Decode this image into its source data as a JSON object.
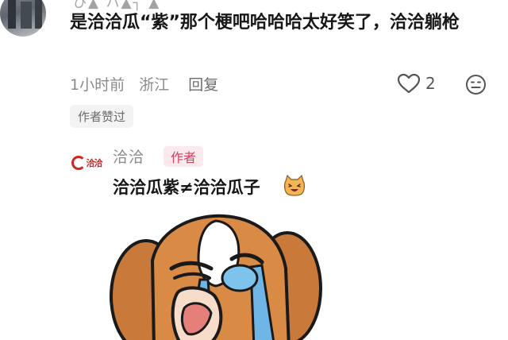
{
  "comment": {
    "username_partial": "ひ▲ ハ▲┐ ▲",
    "text": "是洽洽瓜“紫”那个梗吧哈哈哈太好笑了，洽洽躺枪",
    "time": "1小时前",
    "location": "浙江",
    "reply_label": "回复",
    "like_count": "2",
    "author_liked_badge": "作者赞过"
  },
  "reply": {
    "username": "洽洽",
    "author_tag": "作者",
    "text": "洽洽瓜紫≠洽洽瓜子",
    "avatar_brand": "洽洽"
  },
  "colors": {
    "author_tag_bg": "#fbe9ed",
    "author_tag_text": "#d44263",
    "brand_red": "#d32424"
  }
}
